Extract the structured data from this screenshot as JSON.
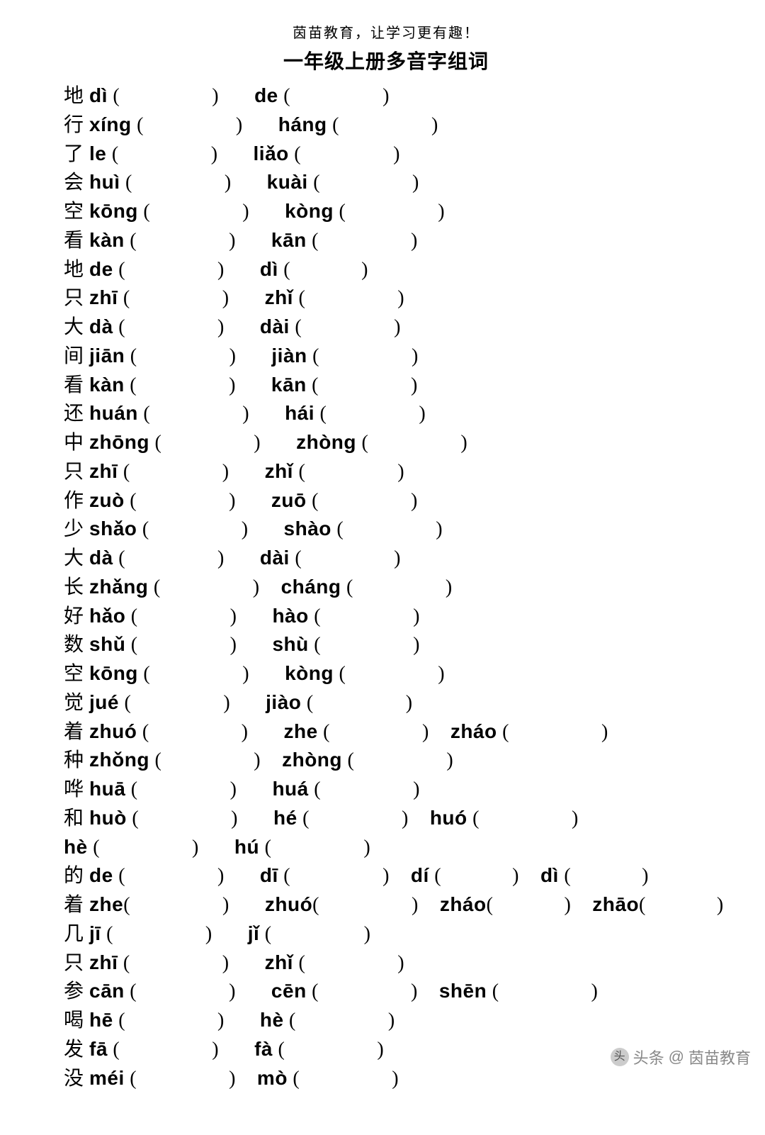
{
  "header": "茵苗教育，让学习更有趣！",
  "title": "一年级上册多音字组词",
  "watermark": {
    "prefix": "头条",
    "at": "@",
    "name": "茵苗教育"
  },
  "rows": [
    {
      "items": [
        {
          "hanzi": "地",
          "py": "dì",
          "gap": "m",
          "sp": "m"
        },
        {
          "hanzi": "",
          "py": "de",
          "gap": "m"
        }
      ]
    },
    {
      "items": [
        {
          "hanzi": "行",
          "py": "xíng",
          "gap": "m",
          "sp": "m"
        },
        {
          "hanzi": "",
          "py": "háng",
          "gap": "m"
        }
      ]
    },
    {
      "items": [
        {
          "hanzi": "了",
          "py": "le",
          "gap": "m",
          "sp": "m"
        },
        {
          "hanzi": "",
          "py": "liǎo",
          "gap": "m"
        }
      ]
    },
    {
      "items": [
        {
          "hanzi": "会",
          "py": "huì",
          "gap": "m",
          "sp": "m"
        },
        {
          "hanzi": "",
          "py": "kuài",
          "gap": "m"
        }
      ]
    },
    {
      "items": [
        {
          "hanzi": "空",
          "py": "kōng",
          "gap": "m",
          "sp": "m"
        },
        {
          "hanzi": "",
          "py": "kòng",
          "gap": "m"
        }
      ]
    },
    {
      "items": [
        {
          "hanzi": "看",
          "py": "kàn",
          "gap": "m",
          "sp": "m"
        },
        {
          "hanzi": "",
          "py": "kān",
          "gap": "m"
        }
      ]
    },
    {
      "items": [
        {
          "hanzi": "地",
          "py": "de",
          "gap": "m",
          "sp": "m"
        },
        {
          "hanzi": "",
          "py": "dì",
          "gap": "s"
        }
      ]
    },
    {
      "items": [
        {
          "hanzi": "只",
          "py": "zhī",
          "gap": "m",
          "sp": "m"
        },
        {
          "hanzi": "",
          "py": "zhǐ",
          "gap": "m"
        }
      ]
    },
    {
      "items": [
        {
          "hanzi": "大",
          "py": "dà",
          "gap": "m",
          "sp": "m"
        },
        {
          "hanzi": "",
          "py": "dài",
          "gap": "m"
        }
      ]
    },
    {
      "items": [
        {
          "hanzi": "间",
          "py": "jiān",
          "gap": "m",
          "sp": "m"
        },
        {
          "hanzi": "",
          "py": "jiàn",
          "gap": "m"
        }
      ]
    },
    {
      "items": [
        {
          "hanzi": "看",
          "py": "kàn",
          "gap": "m",
          "sp": "m"
        },
        {
          "hanzi": "",
          "py": "kān",
          "gap": "m"
        }
      ]
    },
    {
      "items": [
        {
          "hanzi": "还",
          "py": "huán",
          "gap": "m",
          "sp": "m"
        },
        {
          "hanzi": "",
          "py": "hái",
          "gap": "m"
        }
      ]
    },
    {
      "items": [
        {
          "hanzi": "中",
          "py": "zhōng",
          "gap": "m",
          "sp": "m"
        },
        {
          "hanzi": "",
          "py": "zhòng",
          "gap": "m"
        }
      ]
    },
    {
      "items": [
        {
          "hanzi": "只",
          "py": "zhī",
          "gap": "m",
          "sp": "m"
        },
        {
          "hanzi": "",
          "py": "zhǐ",
          "gap": "m"
        }
      ]
    },
    {
      "items": [
        {
          "hanzi": "作",
          "py": "zuò",
          "gap": "m",
          "sp": "m"
        },
        {
          "hanzi": "",
          "py": "zuō",
          "gap": "m"
        }
      ]
    },
    {
      "items": [
        {
          "hanzi": "少",
          "py": "shǎo",
          "gap": "m",
          "sp": "m"
        },
        {
          "hanzi": "",
          "py": "shào",
          "gap": "m"
        }
      ]
    },
    {
      "items": [
        {
          "hanzi": "大",
          "py": "dà",
          "gap": "m",
          "sp": "m"
        },
        {
          "hanzi": "",
          "py": "dài",
          "gap": "m"
        }
      ]
    },
    {
      "items": [
        {
          "hanzi": "长",
          "py": "zhǎng",
          "gap": "m",
          "sp": "s"
        },
        {
          "hanzi": "",
          "py": "cháng",
          "gap": "m"
        }
      ]
    },
    {
      "items": [
        {
          "hanzi": "好",
          "py": "hǎo",
          "gap": "m",
          "sp": "m"
        },
        {
          "hanzi": "",
          "py": "hào",
          "gap": "m"
        }
      ]
    },
    {
      "items": [
        {
          "hanzi": "数",
          "py": "shǔ",
          "gap": "m",
          "sp": "m"
        },
        {
          "hanzi": "",
          "py": "shù",
          "gap": "m"
        }
      ]
    },
    {
      "items": [
        {
          "hanzi": "空",
          "py": "kōng",
          "gap": "m",
          "sp": "m"
        },
        {
          "hanzi": "",
          "py": "kòng",
          "gap": "m"
        }
      ]
    },
    {
      "items": [
        {
          "hanzi": "觉",
          "py": "jué",
          "gap": "m",
          "sp": "m"
        },
        {
          "hanzi": "",
          "py": "jiào",
          "gap": "m"
        }
      ]
    },
    {
      "items": [
        {
          "hanzi": "着",
          "py": "zhuó",
          "gap": "m",
          "sp": "m"
        },
        {
          "hanzi": "",
          "py": "zhe",
          "gap": "m",
          "sp": "s"
        },
        {
          "hanzi": "",
          "py": "zháo",
          "gap": "m"
        }
      ]
    },
    {
      "items": [
        {
          "hanzi": "种",
          "py": "zhǒng",
          "gap": "m",
          "sp": "s"
        },
        {
          "hanzi": "",
          "py": "zhòng",
          "gap": "m"
        }
      ]
    },
    {
      "items": [
        {
          "hanzi": "哗",
          "py": "huā",
          "gap": "m",
          "sp": "m"
        },
        {
          "hanzi": "",
          "py": "huá",
          "gap": "m"
        }
      ]
    },
    {
      "items": [
        {
          "hanzi": "和",
          "py": "huò",
          "gap": "m",
          "sp": "m"
        },
        {
          "hanzi": "",
          "py": "hé",
          "gap": "m",
          "sp": "s"
        },
        {
          "hanzi": "",
          "py": "huó",
          "gap": "m"
        }
      ]
    },
    {
      "items": [
        {
          "hanzi": "",
          "py": "hè",
          "gap": "m",
          "sp": "m"
        },
        {
          "hanzi": "",
          "py": "hú",
          "gap": "m"
        }
      ]
    },
    {
      "items": [
        {
          "hanzi": "的",
          "py": "de",
          "gap": "m",
          "sp": "m"
        },
        {
          "hanzi": "",
          "py": "dī",
          "gap": "m",
          "sp": "s"
        },
        {
          "hanzi": "",
          "py": "dí",
          "gap": "s",
          "sp": "s"
        },
        {
          "hanzi": "",
          "py": "dì",
          "gap": "s"
        }
      ]
    },
    {
      "items": [
        {
          "hanzi": "着",
          "py": "zhe",
          "gap": "m",
          "sp": "m",
          "nosp": true
        },
        {
          "hanzi": "",
          "py": "zhuó",
          "gap": "m",
          "nosp": true,
          "sp": "s"
        },
        {
          "hanzi": "",
          "py": "zháo",
          "gap": "s",
          "nosp": true,
          "sp": "s"
        },
        {
          "hanzi": "",
          "py": "zhāo",
          "gap": "s",
          "nosp": true
        }
      ]
    },
    {
      "items": [
        {
          "hanzi": "几",
          "py": "jī",
          "gap": "m",
          "sp": "m"
        },
        {
          "hanzi": "",
          "py": "jǐ",
          "gap": "m"
        }
      ]
    },
    {
      "items": [
        {
          "hanzi": "只",
          "py": "zhī",
          "gap": "m",
          "sp": "m"
        },
        {
          "hanzi": "",
          "py": "zhǐ",
          "gap": "m"
        }
      ]
    },
    {
      "items": [
        {
          "hanzi": "参",
          "py": "cān",
          "gap": "m",
          "sp": "m"
        },
        {
          "hanzi": "",
          "py": "cēn",
          "gap": "m",
          "sp": "s"
        },
        {
          "hanzi": "",
          "py": "shēn",
          "gap": "m"
        }
      ]
    },
    {
      "items": [
        {
          "hanzi": "喝",
          "py": "hē",
          "gap": "m",
          "sp": "m"
        },
        {
          "hanzi": "",
          "py": "hè",
          "gap": "m"
        }
      ]
    },
    {
      "items": [
        {
          "hanzi": "发",
          "py": "fā",
          "gap": "m",
          "sp": "m"
        },
        {
          "hanzi": "",
          "py": "fà",
          "gap": "m"
        }
      ]
    },
    {
      "items": [
        {
          "hanzi": "没",
          "py": "méi",
          "gap": "m",
          "sp": "s"
        },
        {
          "hanzi": "",
          "py": "mò",
          "gap": "m"
        }
      ]
    }
  ]
}
